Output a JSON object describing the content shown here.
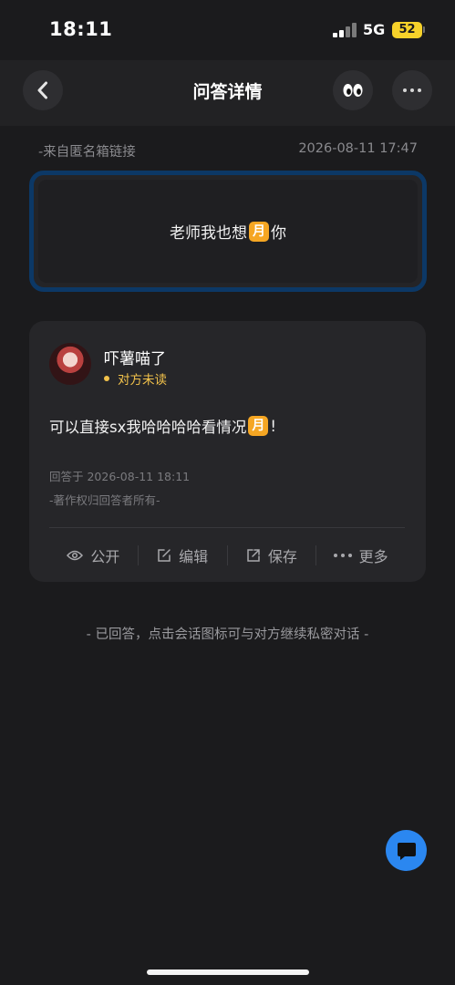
{
  "status_bar": {
    "time": "18:11",
    "network": "5G",
    "battery": "52"
  },
  "nav": {
    "title": "问答详情",
    "back_icon": "chevron-left-icon",
    "eyes_icon": "eyes-emoji-icon",
    "more_icon": "more-dots-icon"
  },
  "question": {
    "source": "-来自匿名箱链接",
    "datetime": "2026-08-11 17:47",
    "text_before": "老师我也想",
    "emoji": "月",
    "text_after": "你"
  },
  "answer": {
    "username": "吓薯喵了",
    "status": "对方未读",
    "text_before": "可以直接sx我哈哈哈哈看情况",
    "emoji": "月",
    "text_after": "!",
    "answered_at": "回答于 2026-08-11 18:11",
    "copyright": "-著作权归回答者所有-",
    "actions": {
      "public": "公开",
      "edit": "编辑",
      "save": "保存",
      "more": "更多"
    }
  },
  "hint": "- 已回答，点击会话图标可与对方继续私密对话 -",
  "colors": {
    "accent_blue": "#2b87f0",
    "unread_yellow": "#f2c24b",
    "card_border": "#0c3866",
    "battery": "#f7d22a"
  }
}
